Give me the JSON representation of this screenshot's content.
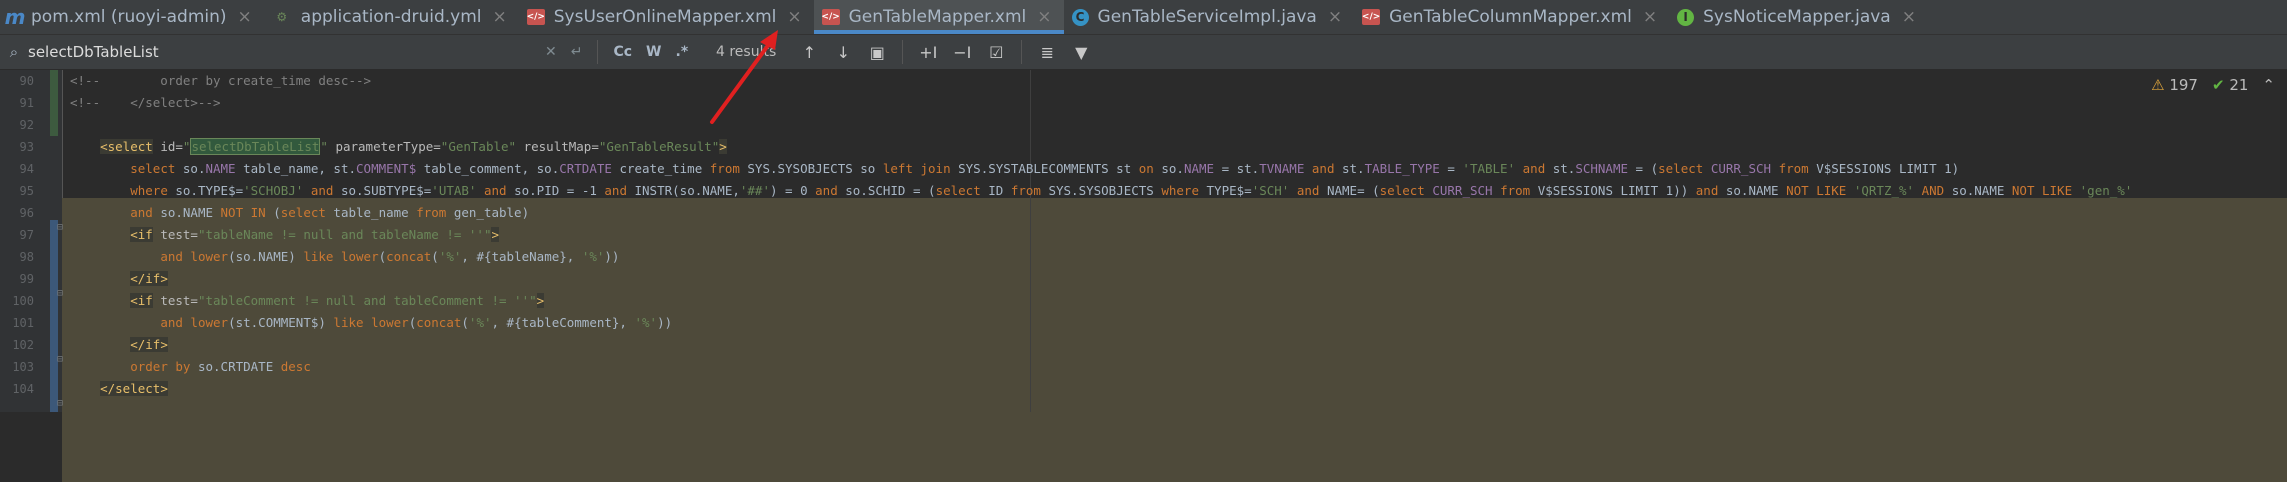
{
  "tabs": [
    {
      "label": "pom.xml (ruoyi-admin)",
      "icon": "maven-icon",
      "glyph": "m",
      "kind": "maven"
    },
    {
      "label": "application-druid.yml",
      "icon": "yml-icon",
      "glyph": "⚙",
      "kind": "yml"
    },
    {
      "label": "SysUserOnlineMapper.xml",
      "icon": "xml-icon",
      "glyph": "</>",
      "kind": "xml"
    },
    {
      "label": "GenTableMapper.xml",
      "icon": "xml-icon",
      "glyph": "</>",
      "kind": "xml",
      "active": true
    },
    {
      "label": "GenTableServiceImpl.java",
      "icon": "java-class-icon",
      "glyph": "C",
      "kind": "java"
    },
    {
      "label": "GenTableColumnMapper.xml",
      "icon": "xml-icon",
      "glyph": "</>",
      "kind": "xml"
    },
    {
      "label": "SysNoticeMapper.java",
      "icon": "java-interface-icon",
      "glyph": "I",
      "kind": "iface"
    }
  ],
  "search": {
    "query": "selectDbTableList",
    "results": "4 results",
    "opt_cc": "Cc",
    "opt_w": "W",
    "opt_regex": ".*"
  },
  "inspection": {
    "warnings": "197",
    "ok": "21"
  },
  "lines": [
    {
      "n": "90",
      "html": "<span class='c-com'>&lt;!--        order by create_time desc--&gt;</span>"
    },
    {
      "n": "91",
      "html": "<span class='c-com'>&lt;!--    &lt;/select&gt;--&gt;</span>"
    },
    {
      "n": "92",
      "html": ""
    },
    {
      "n": "93",
      "html": "    <span class='c-tag tagbg'>&lt;select</span> <span class='c-attr'>id=</span><span class='c-str'>\"<span class='hl-find'>selectDbTableList</span>\"</span> <span class='c-attr'>parameterType=</span><span class='c-str'>\"GenTable\"</span> <span class='c-attr'>resultMap=</span><span class='c-str'>\"GenTableResult\"</span><span class='c-tag tagbg'>&gt;</span>"
    },
    {
      "n": "94",
      "html": "        <span class='c-kw'>select</span> so.<span class='c-id'>NAME</span> table_name, st.<span class='c-id'>COMMENT$</span> table_comment, so.<span class='c-id'>CRTDATE</span> create_time <span class='c-kw'>from</span> SYS.SYSOBJECTS so <span class='c-kw'>left join</span> SYS.SYSTABLECOMMENTS st <span class='c-kw'>on</span> so.<span class='c-id'>NAME</span> = st.<span class='c-id'>TVNAME</span> <span class='c-kw'>and</span> st.<span class='c-id'>TABLE_TYPE</span> = <span class='c-str'>'TABLE'</span> <span class='c-kw'>and</span> st.<span class='c-id'>SCHNAME</span> = (<span class='c-kw'>select</span> <span class='c-id'>CURR_SCH</span> <span class='c-kw'>from</span> V$SESSIONS LIMIT 1)"
    },
    {
      "n": "95",
      "html": "        <span class='c-kw'>where</span> so.TYPE$=<span class='c-str'>'SCHOBJ'</span> <span class='c-kw'>and</span> so.SUBTYPE$=<span class='c-str'>'UTAB'</span> <span class='c-kw'>and</span> so.PID = -1 <span class='c-kw'>and</span> INSTR(so.NAME,<span class='c-str'>'##'</span>) = 0 <span class='c-kw'>and</span> so.SCHID = (<span class='c-kw'>select</span> ID <span class='c-kw'>from</span> SYS.SYSOBJECTS <span class='c-kw'>where</span> TYPE$=<span class='c-str'>'SCH'</span> <span class='c-kw'>and</span> NAME= (<span class='c-kw'>select</span> <span class='c-id'>CURR_SCH</span> <span class='c-kw'>from</span> V$SESSIONS LIMIT 1)) <span class='c-kw'>and</span> so.NAME <span class='c-kw'>NOT LIKE</span> <span class='c-str'>'QRTZ_%'</span> <span class='c-kw'>AND</span> so.NAME <span class='c-kw'>NOT LIKE</span> <span class='c-str'>'gen_%'</span>"
    },
    {
      "n": "96",
      "html": "        <span class='c-kw'>and</span> so.NAME <span class='c-kw'>NOT IN</span> (<span class='c-kw'>select</span> table_name <span class='c-kw'>from</span> gen_table)"
    },
    {
      "n": "97",
      "html": "        <span class='c-tag tagbg'>&lt;if</span> <span class='c-attr'>test=</span><span class='c-str'>\"tableName != null and tableName != ''\"</span><span class='c-tag tagbg'>&gt;</span>"
    },
    {
      "n": "98",
      "html": "            <span class='c-kw'>and</span> <span class='c-kw'>lower</span>(so.NAME) <span class='c-kw'>like</span> <span class='c-kw'>lower</span>(<span class='c-kw'>concat</span>(<span class='c-str'>'%'</span>, #{tableName}, <span class='c-str'>'%'</span>))"
    },
    {
      "n": "99",
      "html": "        <span class='c-tag tagbg'>&lt;/if&gt;</span>"
    },
    {
      "n": "100",
      "html": "        <span class='c-tag tagbg'>&lt;if</span> <span class='c-attr'>test=</span><span class='c-str'>\"tableComment != null and tableComment != ''\"</span><span class='c-tag tagbg'>&gt;</span>"
    },
    {
      "n": "101",
      "html": "            <span class='c-kw'>and</span> <span class='c-kw'>lower</span>(st.COMMENT$) <span class='c-kw'>like</span> <span class='c-kw'>lower</span>(<span class='c-kw'>concat</span>(<span class='c-str'>'%'</span>, #{tableComment}, <span class='c-str'>'%'</span>))"
    },
    {
      "n": "102",
      "html": "        <span class='c-tag tagbg'>&lt;/if&gt;</span>"
    },
    {
      "n": "103",
      "html": "        <span class='c-kw'>order by</span> so.CRTDATE <span class='c-kw'>desc</span>"
    },
    {
      "n": "104",
      "html": "    <span class='c-tag tagbg'>&lt;/select&gt;</span>"
    }
  ]
}
